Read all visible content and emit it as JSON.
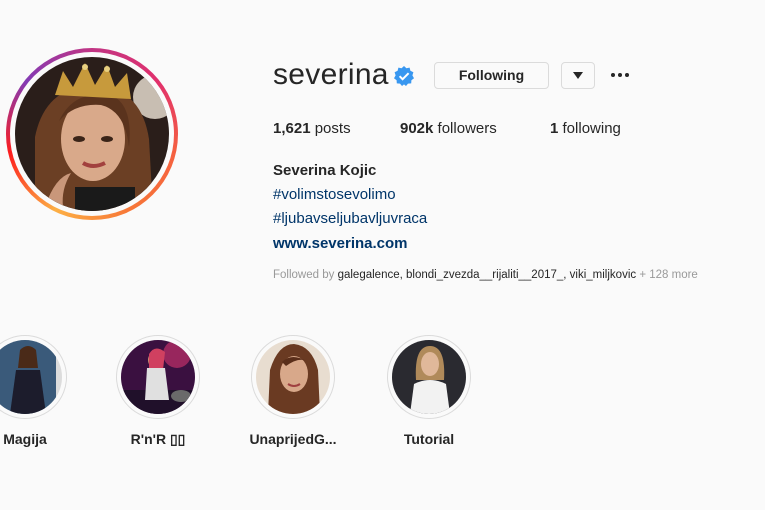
{
  "profile": {
    "username": "severina",
    "verified": true,
    "following_button": "Following",
    "dropdown_icon": "triangle-down-icon",
    "more_icon": "ellipsis-icon"
  },
  "stats": {
    "posts_count": "1,621",
    "posts_label": "posts",
    "followers_count": "902k",
    "followers_label": "followers",
    "following_count": "1",
    "following_label": "following"
  },
  "bio": {
    "full_name": "Severina Kojic",
    "hashtags": [
      "#volimstosevolimo",
      "#ljubavseljubavljuvraca"
    ],
    "website": "www.severina.com"
  },
  "followed_by": {
    "prefix": "Followed by",
    "names": "galegalence, blondi_zvezda__rijaliti__2017_, viki_miljkovic",
    "suffix": "+ 128 more"
  },
  "highlights": [
    {
      "label": "Magija"
    },
    {
      "label": "R'n'R ▯▯"
    },
    {
      "label": "UnaprijedG..."
    },
    {
      "label": "Tutorial"
    }
  ],
  "colors": {
    "accent_link": "#003569",
    "verified_blue": "#3897f0",
    "border": "#dbdbdb",
    "background": "#fafafa"
  }
}
